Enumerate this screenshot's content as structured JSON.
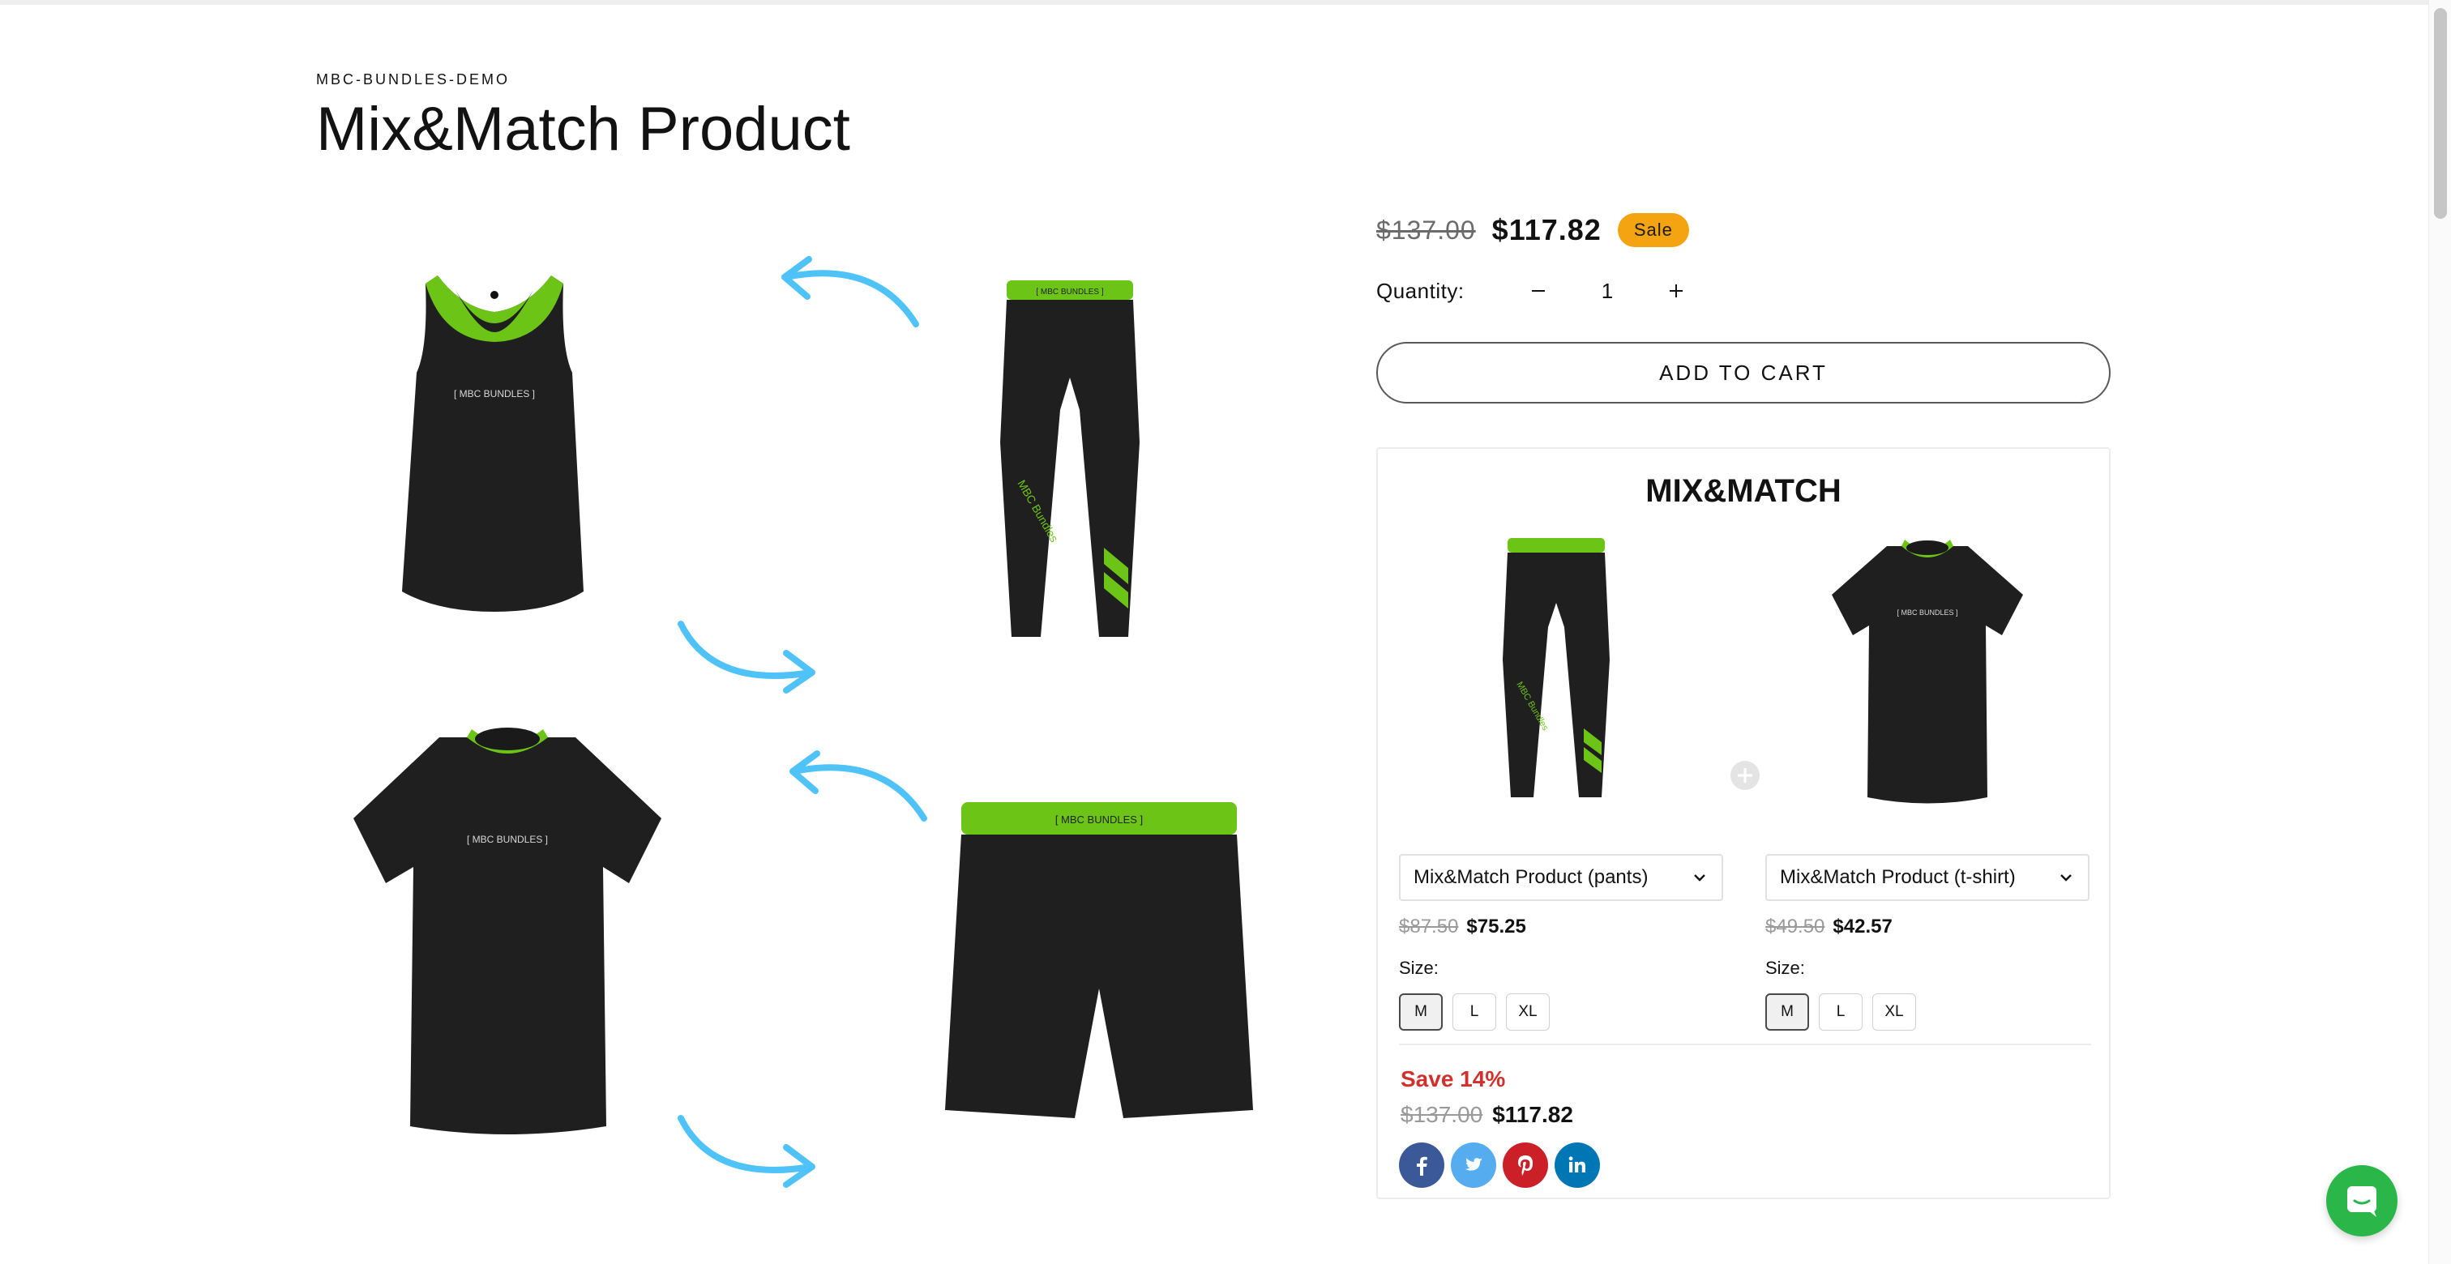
{
  "store": {
    "vendor": "MBC-BUNDLES-DEMO"
  },
  "product": {
    "title": "Mix&Match Product",
    "compare_price": "$137.00",
    "price": "$117.82",
    "badge": "Sale",
    "quantity_label": "Quantity:",
    "quantity_value": "1",
    "add_to_cart": "ADD TO CART"
  },
  "bundle": {
    "title": "MIX&MATCH",
    "items": [
      {
        "select_value": "Mix&Match Product (pants)",
        "old_price": "$87.50",
        "new_price": "$75.25",
        "size_label": "Size:",
        "sizes": [
          "M",
          "L",
          "XL"
        ],
        "selected_size": "M"
      },
      {
        "select_value": "Mix&Match Product (t-shirt)",
        "old_price": "$49.50",
        "new_price": "$42.57",
        "size_label": "Size:",
        "sizes": [
          "M",
          "L",
          "XL"
        ],
        "selected_size": "M"
      }
    ],
    "save_text": "Save 14%",
    "total_old": "$137.00",
    "total_new": "$117.82"
  },
  "social": [
    {
      "name": "facebook-icon",
      "glyph": "f",
      "color": "#3b5998"
    },
    {
      "name": "twitter-icon",
      "glyph": "t",
      "color": "#55acee"
    },
    {
      "name": "pinterest-icon",
      "glyph": "p",
      "color": "#cb2027"
    },
    {
      "name": "linkedin-icon",
      "glyph": "in",
      "color": "#0077b5"
    }
  ],
  "product_images": {
    "tank_text": "[ MBC BUNDLES ]",
    "pants_text": "[ MBC BUNDLES ]",
    "tshirt_text": "[ MBC BUNDLES ]",
    "shorts_text": "[ MBC BUNDLES ]"
  },
  "colors": {
    "accent_green": "#6cc417",
    "arrow_blue": "#4fc3f7",
    "sale_badge": "#f4a410",
    "save_red": "#d0312d"
  }
}
